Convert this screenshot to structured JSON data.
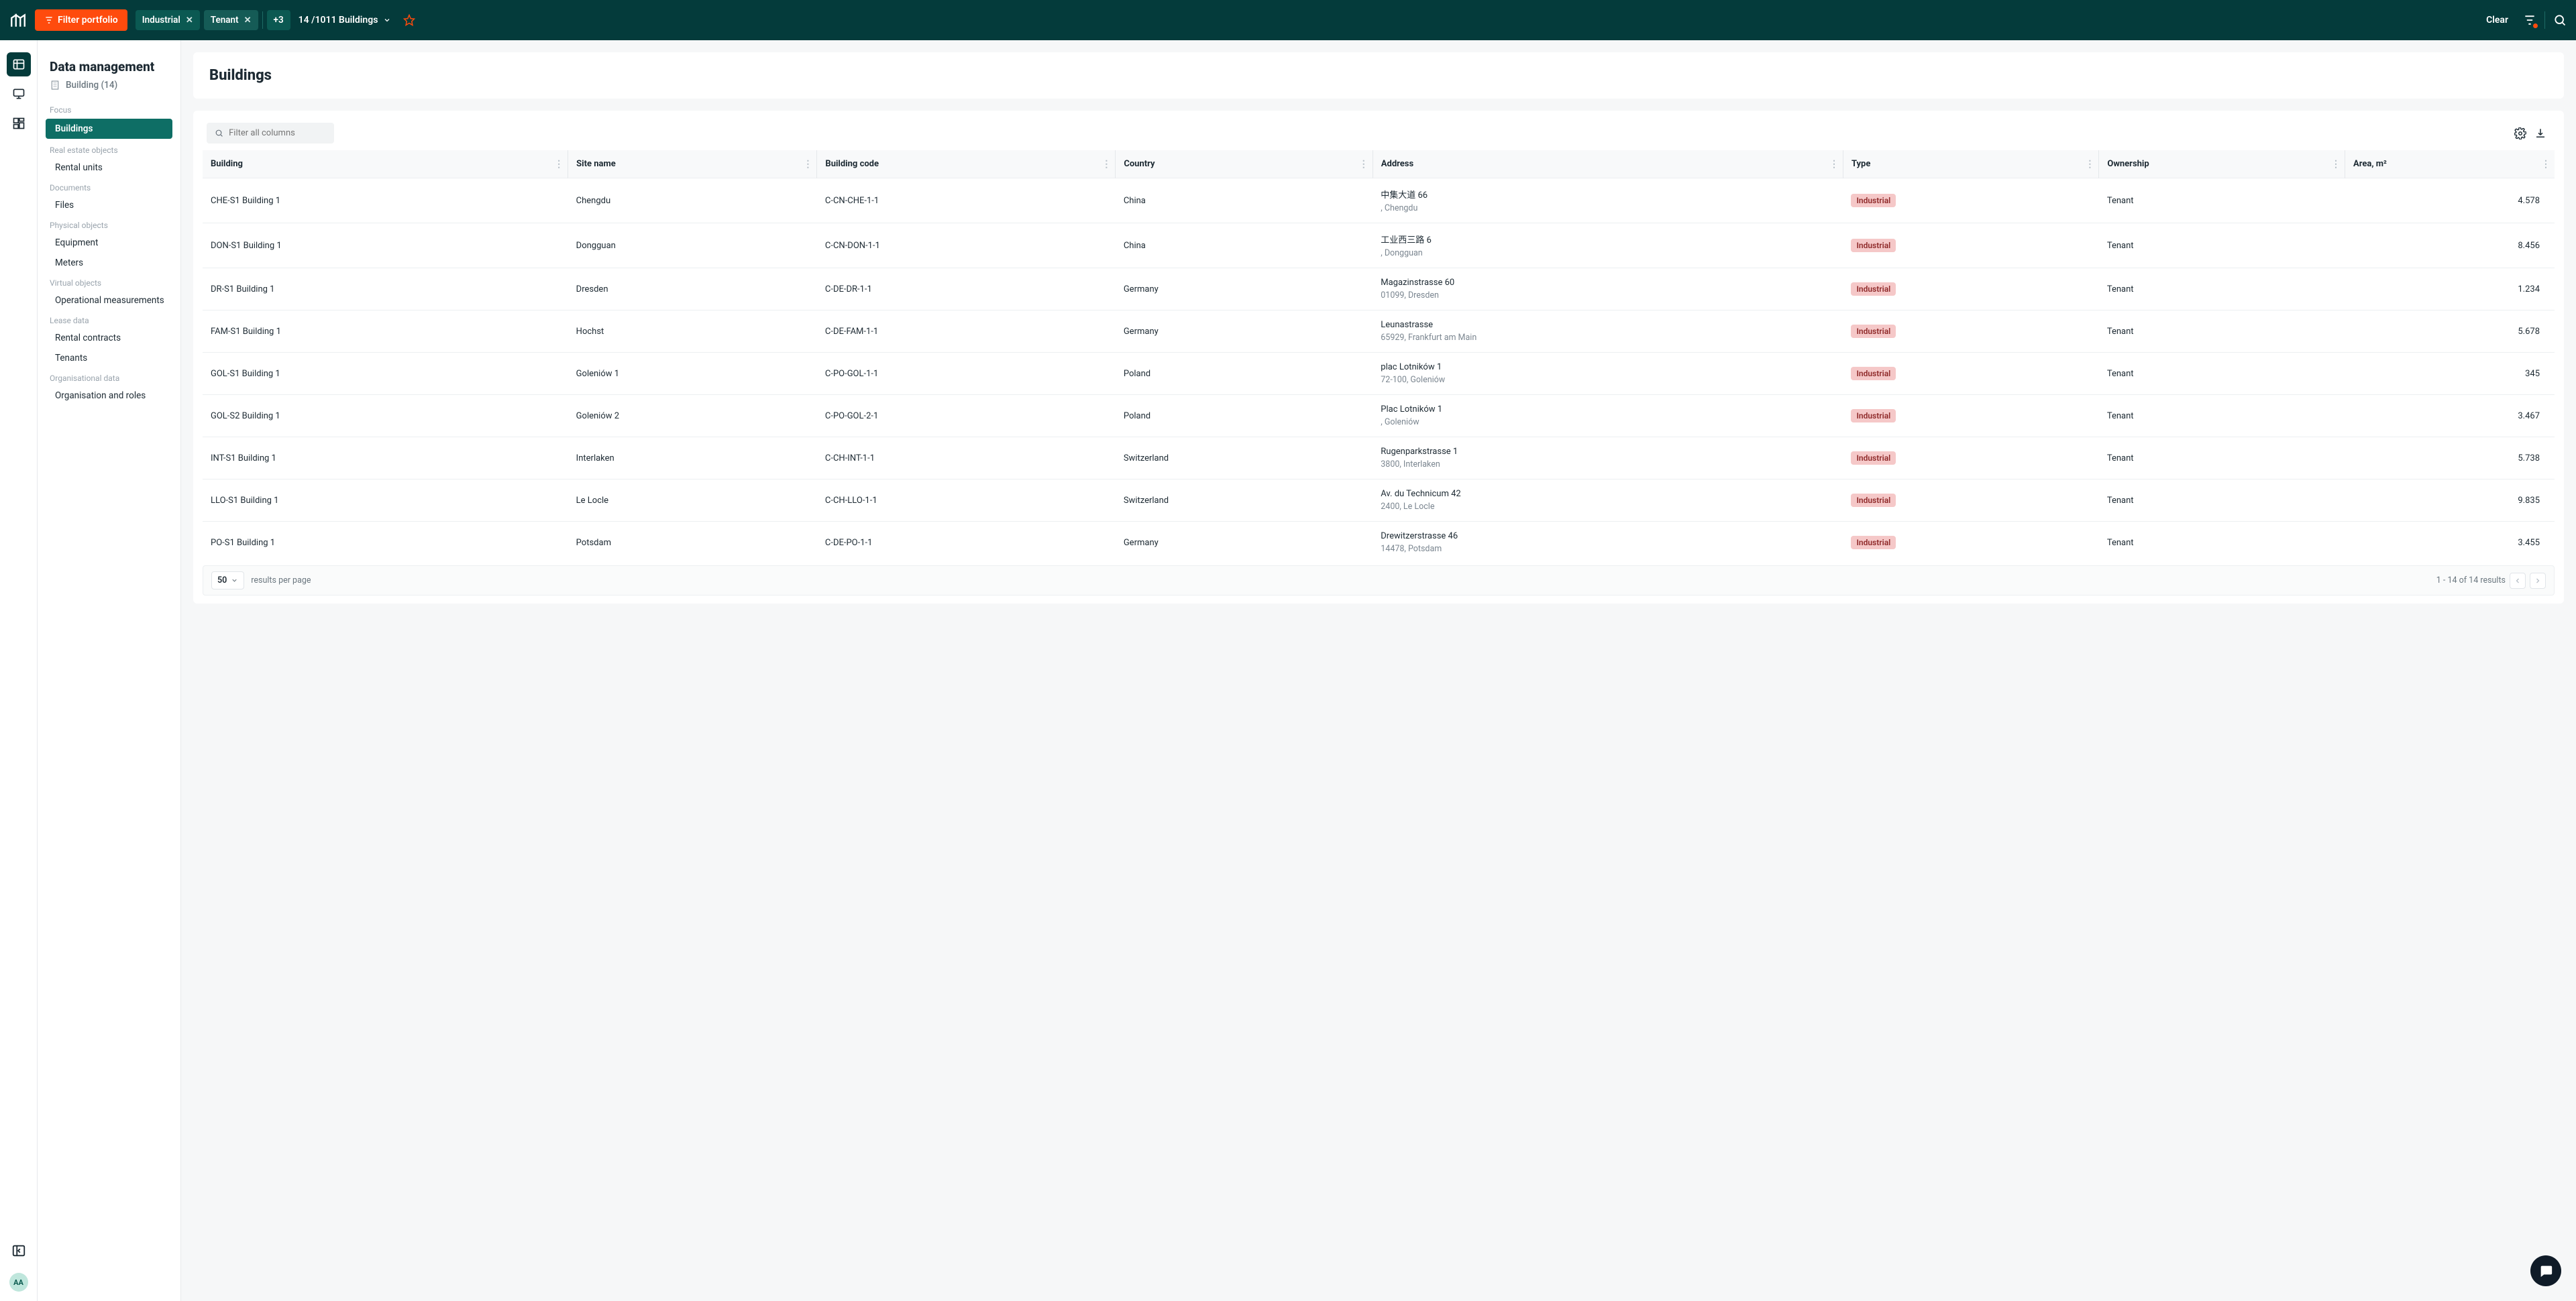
{
  "topbar": {
    "filter_label": "Filter portfolio",
    "chips": [
      "Industrial",
      "Tenant"
    ],
    "more_chip": "+3",
    "summary": "14 /1011 Buildings",
    "clear": "Clear"
  },
  "sidebar": {
    "title": "Data management",
    "subtitle": "Building (14)",
    "groups": [
      {
        "label": "Focus",
        "items": [
          {
            "label": "Buildings",
            "active": true
          }
        ]
      },
      {
        "label": "Real estate objects",
        "items": [
          {
            "label": "Rental units"
          }
        ]
      },
      {
        "label": "Documents",
        "items": [
          {
            "label": "Files"
          }
        ]
      },
      {
        "label": "Physical objects",
        "items": [
          {
            "label": "Equipment"
          },
          {
            "label": "Meters"
          }
        ]
      },
      {
        "label": "Virtual objects",
        "items": [
          {
            "label": "Operational measurements"
          }
        ]
      },
      {
        "label": "Lease data",
        "items": [
          {
            "label": "Rental contracts"
          },
          {
            "label": "Tenants"
          }
        ]
      },
      {
        "label": "Organisational data",
        "items": [
          {
            "label": "Organisation and roles"
          }
        ]
      }
    ]
  },
  "page": {
    "title": "Buildings"
  },
  "table": {
    "filter_placeholder": "Filter all columns",
    "columns": [
      "Building",
      "Site name",
      "Building code",
      "Country",
      "Address",
      "Type",
      "Ownership",
      "Area, m²"
    ],
    "rows": [
      {
        "building": "CHE-S1 Building 1",
        "site": "Chengdu",
        "code": "C-CN-CHE-1-1",
        "country": "China",
        "addr1": "中集大道 66",
        "addr2": ", Chengdu",
        "type": "Industrial",
        "ownership": "Tenant",
        "area": "4.578"
      },
      {
        "building": "DON-S1 Building 1",
        "site": "Dongguan",
        "code": "C-CN-DON-1-1",
        "country": "China",
        "addr1": "工业西三路 6",
        "addr2": ", Dongguan",
        "type": "Industrial",
        "ownership": "Tenant",
        "area": "8.456"
      },
      {
        "building": "DR-S1 Building 1",
        "site": "Dresden",
        "code": "C-DE-DR-1-1",
        "country": "Germany",
        "addr1": "Magazinstrasse 60",
        "addr2": "01099, Dresden",
        "type": "Industrial",
        "ownership": "Tenant",
        "area": "1.234"
      },
      {
        "building": "FAM-S1 Building 1",
        "site": "Hochst",
        "code": "C-DE-FAM-1-1",
        "country": "Germany",
        "addr1": "Leunastrasse",
        "addr2": "65929, Frankfurt am Main",
        "type": "Industrial",
        "ownership": "Tenant",
        "area": "5.678"
      },
      {
        "building": "GOL-S1 Building 1",
        "site": "Goleniów 1",
        "code": "C-PO-GOL-1-1",
        "country": "Poland",
        "addr1": "plac Lotników 1",
        "addr2": "72-100, Goleniów",
        "type": "Industrial",
        "ownership": "Tenant",
        "area": "345"
      },
      {
        "building": "GOL-S2 Building 1",
        "site": "Goleniów 2",
        "code": "C-PO-GOL-2-1",
        "country": "Poland",
        "addr1": "Plac Lotników 1",
        "addr2": ", Goleniów",
        "type": "Industrial",
        "ownership": "Tenant",
        "area": "3.467"
      },
      {
        "building": "INT-S1 Building 1",
        "site": "Interlaken",
        "code": "C-CH-INT-1-1",
        "country": "Switzerland",
        "addr1": "Rugenparkstrasse 1",
        "addr2": "3800, Interlaken",
        "type": "Industrial",
        "ownership": "Tenant",
        "area": "5.738"
      },
      {
        "building": "LLO-S1 Building 1",
        "site": "Le Locle",
        "code": "C-CH-LLO-1-1",
        "country": "Switzerland",
        "addr1": "Av. du Technicum 42",
        "addr2": "2400, Le Locle",
        "type": "Industrial",
        "ownership": "Tenant",
        "area": "9.835"
      },
      {
        "building": "PO-S1 Building 1",
        "site": "Potsdam",
        "code": "C-DE-PO-1-1",
        "country": "Germany",
        "addr1": "Drewitzerstrasse 46",
        "addr2": "14478, Potsdam",
        "type": "Industrial",
        "ownership": "Tenant",
        "area": "3.455"
      }
    ],
    "page_size": "50",
    "page_size_label": "results per page",
    "results_summary": "1 - 14 of 14 results"
  },
  "avatar": "AA"
}
